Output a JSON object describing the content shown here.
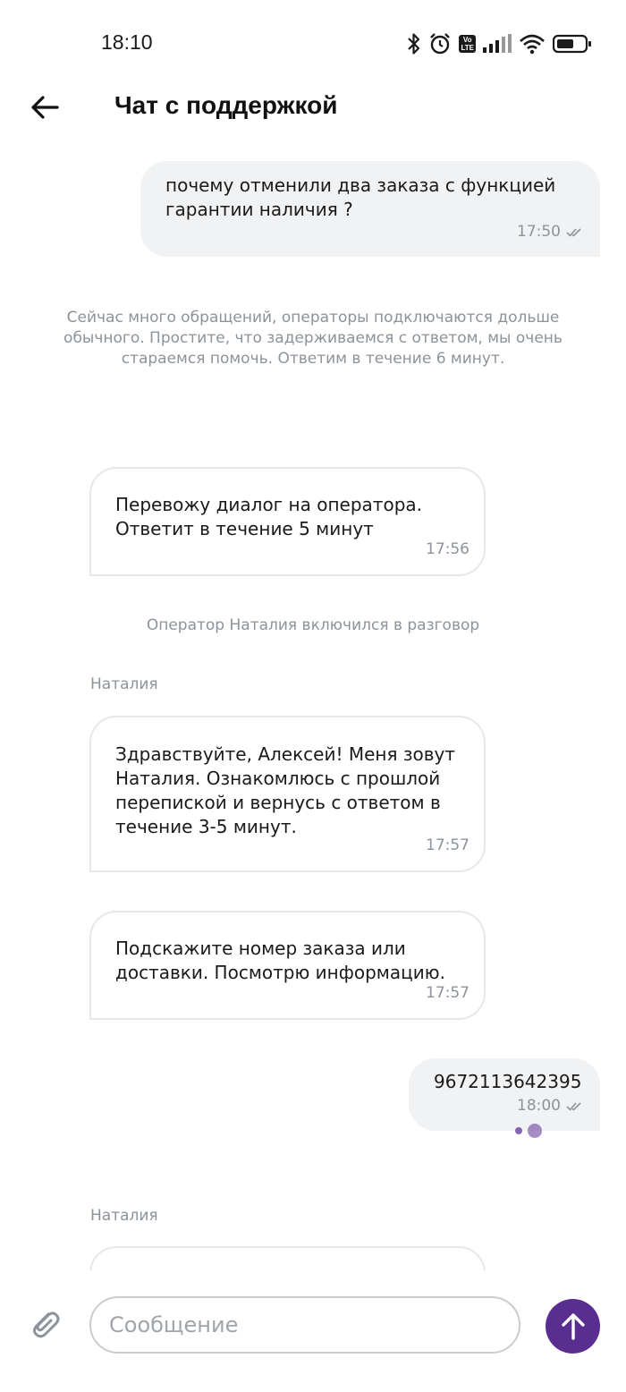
{
  "status_bar": {
    "time": "18:10",
    "icons": [
      "bluetooth-icon",
      "alarm-icon",
      "volte-icon",
      "signal-icon",
      "wifi-icon",
      "battery-icon"
    ],
    "volte_label_top": "Vo",
    "volte_label_bottom": "LTE"
  },
  "header": {
    "title": "Чат с поддержкой",
    "back_icon": "arrow-left-icon"
  },
  "messages": [
    {
      "type": "outgoing",
      "text_lines": [
        "почему отменили два заказа с функцией",
        "гарантии наличия ?"
      ],
      "time": "17:50",
      "status": "read"
    },
    {
      "type": "system",
      "text_lines": [
        "Сейчас много обращений, операторы подключаются дольше",
        "обычного. Простите, что задерживаемся с ответом, мы очень",
        "стараемся помочь. Ответим в течение 6 минут."
      ]
    },
    {
      "type": "incoming",
      "text_lines": [
        "Перевожу диалог на оператора.",
        "Ответит в течение 5 минут"
      ],
      "time": "17:56"
    },
    {
      "type": "system",
      "text_lines": [
        "Оператор Наталия включился в разговор"
      ]
    },
    {
      "type": "sender",
      "name": "Наталия"
    },
    {
      "type": "incoming",
      "text_lines": [
        "Здравствуйте, Алексей! Меня зовут",
        "Наталия. Ознакомлюсь с прошлой",
        "перепиской и вернусь с ответом в",
        "течение 3-5 минут."
      ],
      "time": "17:57"
    },
    {
      "type": "incoming",
      "text_lines": [
        "Подскажите номер заказа или",
        "доставки. Посмотрю информацию."
      ],
      "time": "17:57"
    },
    {
      "type": "outgoing",
      "text_lines": [
        "9672113642395"
      ],
      "time": "18:00",
      "status": "read"
    },
    {
      "type": "sender",
      "name": "Наталия"
    }
  ],
  "composer": {
    "placeholder": "Сообщение",
    "value": "",
    "attach_icon": "paperclip-icon",
    "send_icon": "arrow-up-icon"
  },
  "colors": {
    "accent": "#5a2d91",
    "outgoing_bubble": "#f0f2f4",
    "meta_text": "#8c939a"
  }
}
